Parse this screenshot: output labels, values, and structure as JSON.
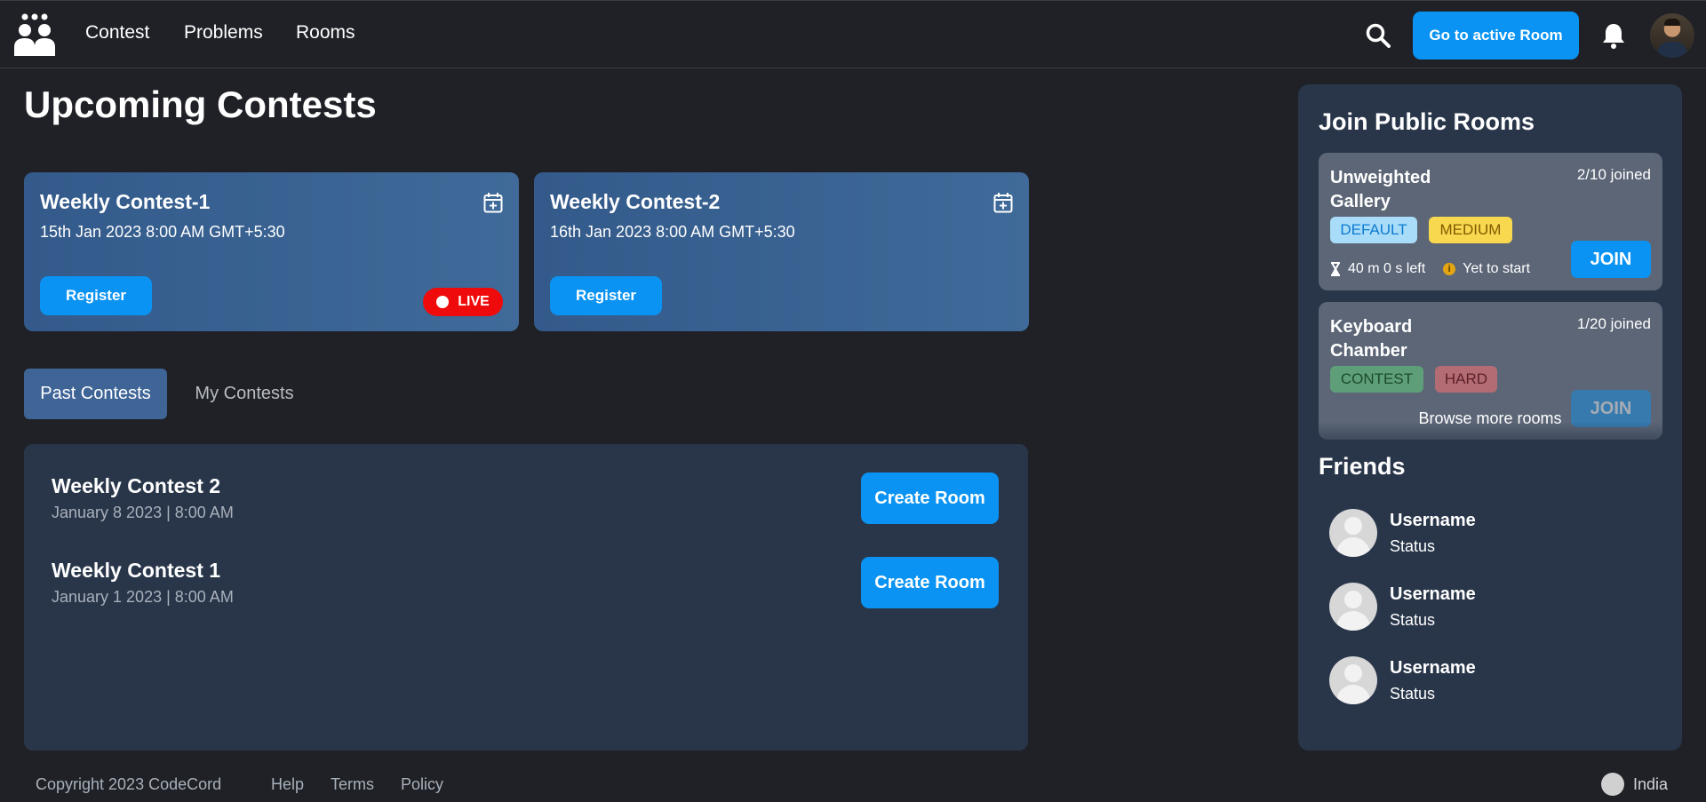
{
  "nav": {
    "links": [
      "Contest",
      "Problems",
      "Rooms"
    ],
    "active_room_button": "Go to active Room"
  },
  "page_title": "Upcoming Contests",
  "upcoming_contests": [
    {
      "title": "Weekly Contest-1",
      "date": "15th Jan 2023 8:00 AM GMT+5:30",
      "register_label": "Register",
      "live_label": "LIVE"
    },
    {
      "title": "Weekly Contest-2",
      "date": "16th Jan 2023 8:00 AM GMT+5:30",
      "register_label": "Register"
    }
  ],
  "tabs": {
    "past": "Past Contests",
    "mine": "My Contests"
  },
  "past_contests": [
    {
      "title": "Weekly Contest 2",
      "date": "January 8 2023 | 8:00 AM",
      "button": "Create Room"
    },
    {
      "title": "Weekly Contest 1",
      "date": "January 1 2023 | 8:00 AM",
      "button": "Create Room"
    }
  ],
  "sidebar": {
    "rooms_heading": "Join Public Rooms",
    "rooms": [
      {
        "name": "Unweighted Gallery",
        "joined": "2/10 joined",
        "type": "DEFAULT",
        "difficulty": "MEDIUM",
        "time_left": "40 m 0 s left",
        "status": "Yet to start",
        "join_label": "JOIN"
      },
      {
        "name": "Keyboard Chamber",
        "joined": "1/20 joined",
        "type": "CONTEST",
        "difficulty": "HARD",
        "join_label": "JOIN"
      }
    ],
    "browse_more": "Browse more rooms",
    "friends_heading": "Friends",
    "friends": [
      {
        "name": "Username",
        "status": "Status"
      },
      {
        "name": "Username",
        "status": "Status"
      },
      {
        "name": "Username",
        "status": "Status"
      }
    ]
  },
  "footer": {
    "copyright": "Copyright 2023 CodeCord",
    "links": [
      "Help",
      "Terms",
      "Policy"
    ],
    "region": "India"
  },
  "colors": {
    "background": "#1f2126",
    "panel": "#29364a",
    "accent": "#0a93f2",
    "live": "#ef0b0b"
  }
}
